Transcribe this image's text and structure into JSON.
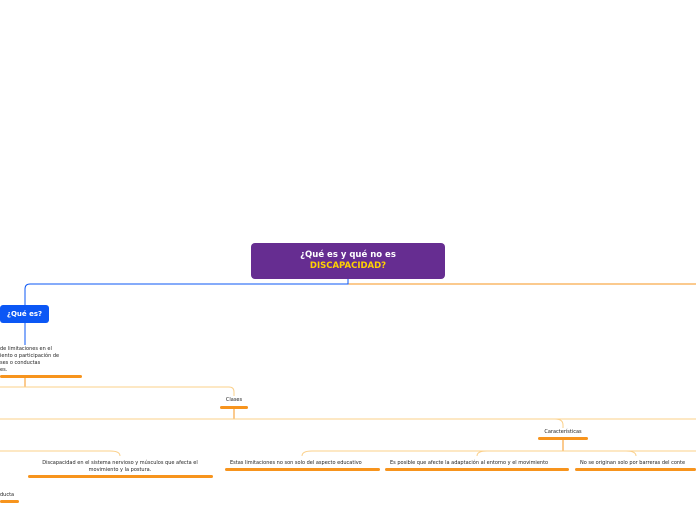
{
  "root": {
    "line1": "¿Qué es y qué no es",
    "line2": "DISCAPACIDAD?",
    "bg_color": "#662d91",
    "accent_color": "#ffd200"
  },
  "que_es": {
    "title": "¿Qué es?",
    "color": "#0b57f5",
    "definition": [
      "de limitaciones en el",
      "iento o  participación de",
      "ses o conductas",
      "es."
    ]
  },
  "clases": {
    "label": "Clases",
    "items": [
      {
        "line1": "Discapacidad en el sistema nervioso y músculos que afecta el",
        "line2": "movimiento y la postura."
      },
      {
        "line1": "ducta"
      }
    ]
  },
  "caracteristicas": {
    "label": "Características",
    "items": [
      "Estas limitaciones no son solo del aspecto educativo",
      "Es posible que afecte la adaptación al entorno y el movimiento",
      "No se originan solo por barreras del conte"
    ]
  },
  "colors": {
    "branch_orange": "#f7941d",
    "branch_blue": "#0b57f5",
    "link_light": "#fbd08a"
  }
}
